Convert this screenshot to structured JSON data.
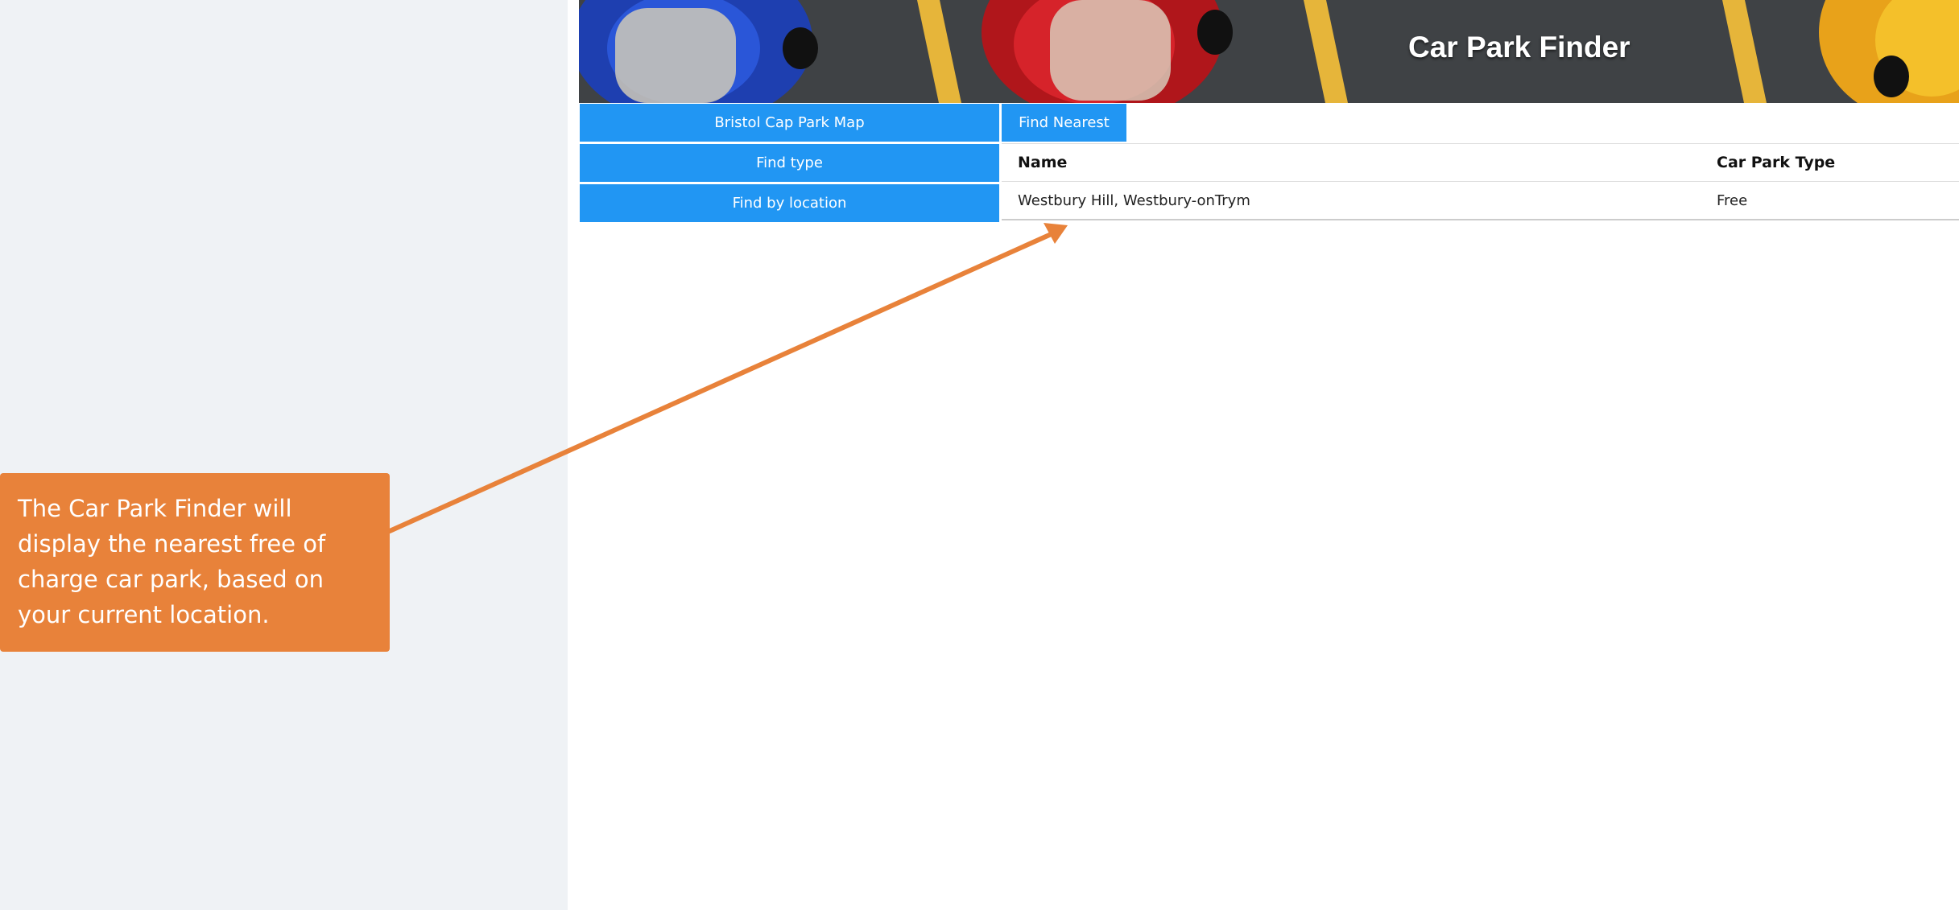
{
  "banner": {
    "title": "Car Park Finder"
  },
  "nav": {
    "map_label": "Bristol Cap Park Map",
    "type_label": "Find type",
    "location_label": "Find by location",
    "nearest_label": "Find Nearest"
  },
  "results": {
    "headers": [
      "Name",
      "Car Park Type"
    ],
    "rows": [
      [
        "Westbury Hill, Westbury-onTrym",
        "Free"
      ]
    ]
  },
  "callout": {
    "text": "The Car Park Finder will display the nearest free of charge car park, based on your current location."
  },
  "colors": {
    "accent_blue": "#2196f3",
    "callout_orange": "#e8823a",
    "sidebar_bg": "#eff2f5"
  }
}
